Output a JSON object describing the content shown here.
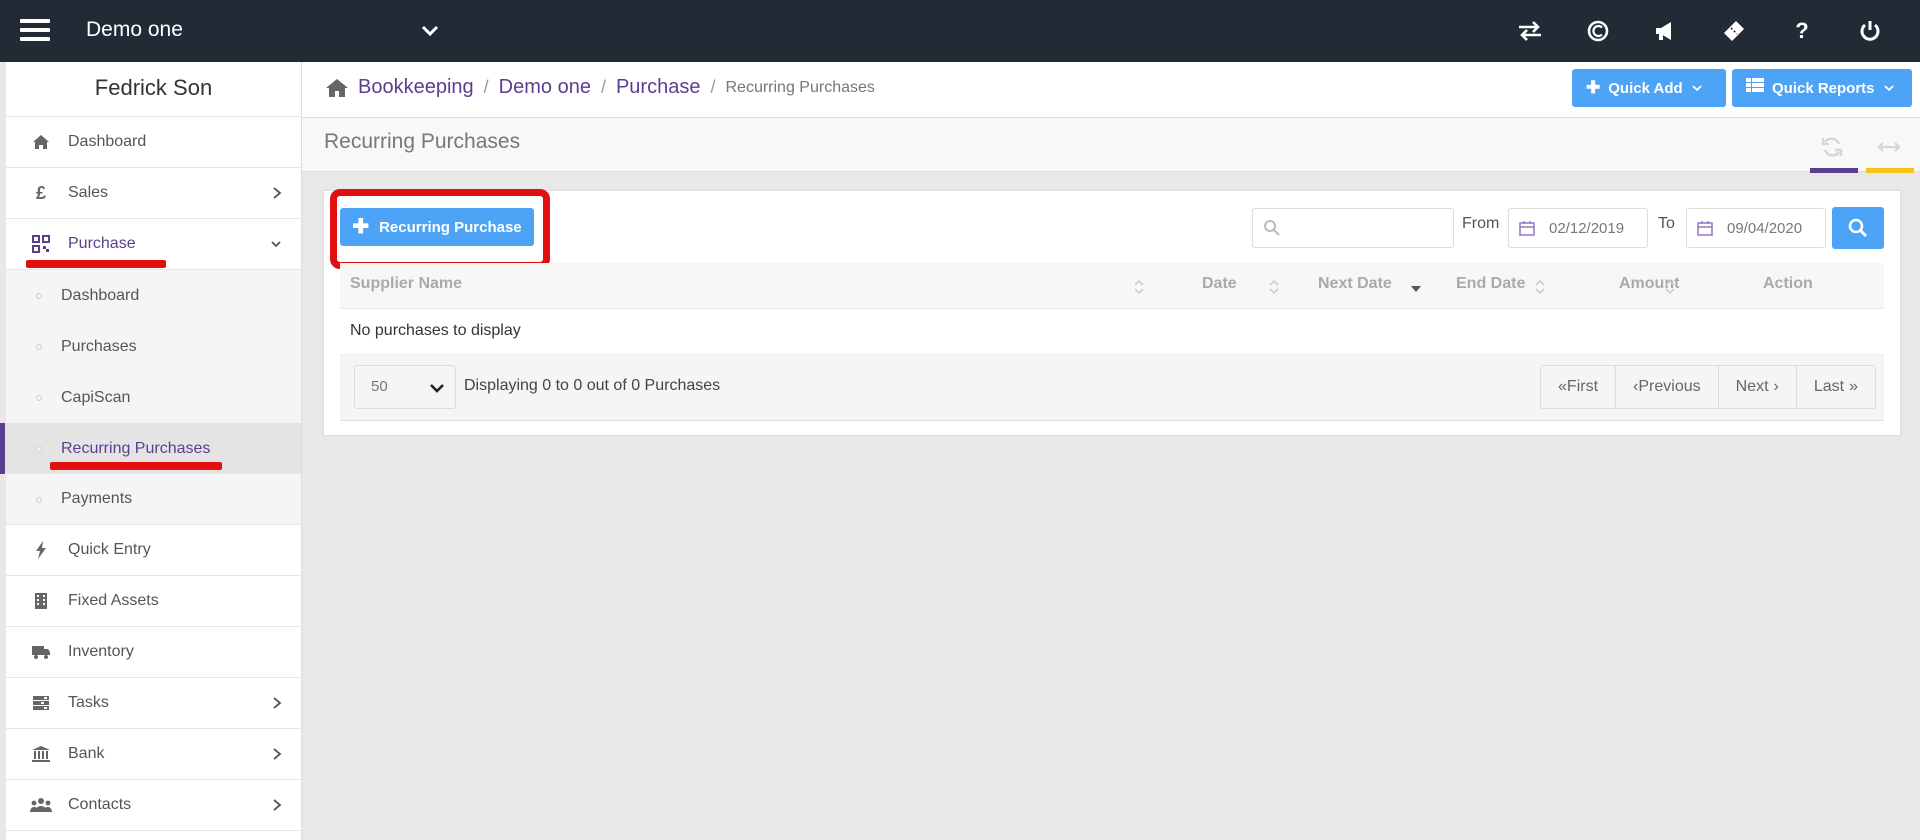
{
  "topbar": {
    "company": "Demo one",
    "icons": [
      "transfer-icon",
      "capium-logo-icon",
      "megaphone-icon",
      "ticket-icon",
      "help-icon",
      "power-icon"
    ]
  },
  "sidebar": {
    "user_name": "Fedrick Son",
    "items": [
      {
        "label": "Dashboard",
        "icon": "home-icon"
      },
      {
        "label": "Sales",
        "icon": "pound-icon",
        "has_children": true
      },
      {
        "label": "Purchase",
        "icon": "qr-icon",
        "expanded": true
      },
      {
        "label": "Quick Entry",
        "icon": "bolt-icon"
      },
      {
        "label": "Fixed Assets",
        "icon": "building-icon"
      },
      {
        "label": "Inventory",
        "icon": "truck-icon"
      },
      {
        "label": "Tasks",
        "icon": "tasks-icon",
        "has_children": true
      },
      {
        "label": "Bank",
        "icon": "bank-icon",
        "has_children": true
      },
      {
        "label": "Contacts",
        "icon": "users-icon",
        "has_children": true
      }
    ],
    "purchase_sub": [
      {
        "label": "Dashboard"
      },
      {
        "label": "Purchases"
      },
      {
        "label": "CapiScan"
      },
      {
        "label": "Recurring Purchases",
        "current": true
      },
      {
        "label": "Payments"
      }
    ]
  },
  "breadcrumb": {
    "items": [
      "Bookkeeping",
      "Demo one",
      "Purchase"
    ],
    "current": "Recurring Purchases"
  },
  "quick": {
    "add_label": "Quick Add",
    "reports_label": "Quick Reports"
  },
  "page": {
    "title": "Recurring Purchases",
    "accent_colors": [
      "#5a3f8f",
      "#f5c518"
    ]
  },
  "toolbar": {
    "add_label": "Recurring Purchase",
    "search_placeholder": "",
    "from_label": "From",
    "from_date": "02/12/2019",
    "to_label": "To",
    "to_date": "09/04/2020"
  },
  "table": {
    "columns": [
      "Supplier Name",
      "Date",
      "Next Date",
      "End Date",
      "Amount",
      "Action"
    ],
    "empty_message": "No purchases to display"
  },
  "footer": {
    "page_size": "50",
    "display_text": "Displaying 0 to 0 out of 0 Purchases",
    "first": "First",
    "previous": "Previous",
    "next": "Next",
    "last": "Last"
  },
  "colors": {
    "topbar": "#222a35",
    "primary": "#4da3f5",
    "accent": "#5a3f8f",
    "highlight": "#e01010"
  }
}
